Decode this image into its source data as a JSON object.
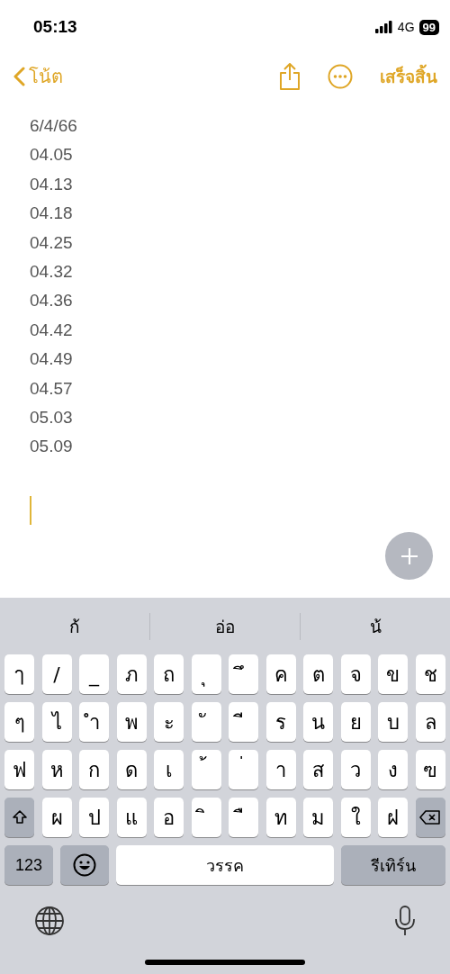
{
  "status_bar": {
    "time": "05:13",
    "network": "4G",
    "battery": "99"
  },
  "nav": {
    "back_label": "โน้ต",
    "done_label": "เสร็จสิ้น"
  },
  "note": {
    "lines": [
      "6/4/66",
      "04.05",
      "04.13",
      "04.18",
      "04.25",
      "04.32",
      "04.36",
      "04.42",
      "04.49",
      "04.57",
      "05.03",
      "05.09"
    ]
  },
  "keyboard": {
    "suggestions": [
      "ก้",
      "อ่อ",
      "น้"
    ],
    "rows": [
      [
        "ๅ",
        "/",
        "_",
        "ภ",
        "ถ",
        "ุ",
        "ึ",
        "ค",
        "ต",
        "จ",
        "ข",
        "ช"
      ],
      [
        "ๆ",
        "ไ",
        "ำ",
        "พ",
        "ะ",
        "ั",
        "ี",
        "ร",
        "น",
        "ย",
        "บ",
        "ล"
      ],
      [
        "ฟ",
        "ห",
        "ก",
        "ด",
        "เ",
        "้",
        "่",
        "า",
        "ส",
        "ว",
        "ง",
        "ฃ"
      ],
      [
        {
          "kind": "shift"
        },
        "ผ",
        "ป",
        "แ",
        "อ",
        "ิ",
        "ื",
        "ท",
        "ม",
        "ใ",
        "ฝ",
        {
          "kind": "delete"
        }
      ]
    ],
    "numbers_label": "123",
    "space_label": "วรรค",
    "return_label": "รีเทิร์น"
  }
}
